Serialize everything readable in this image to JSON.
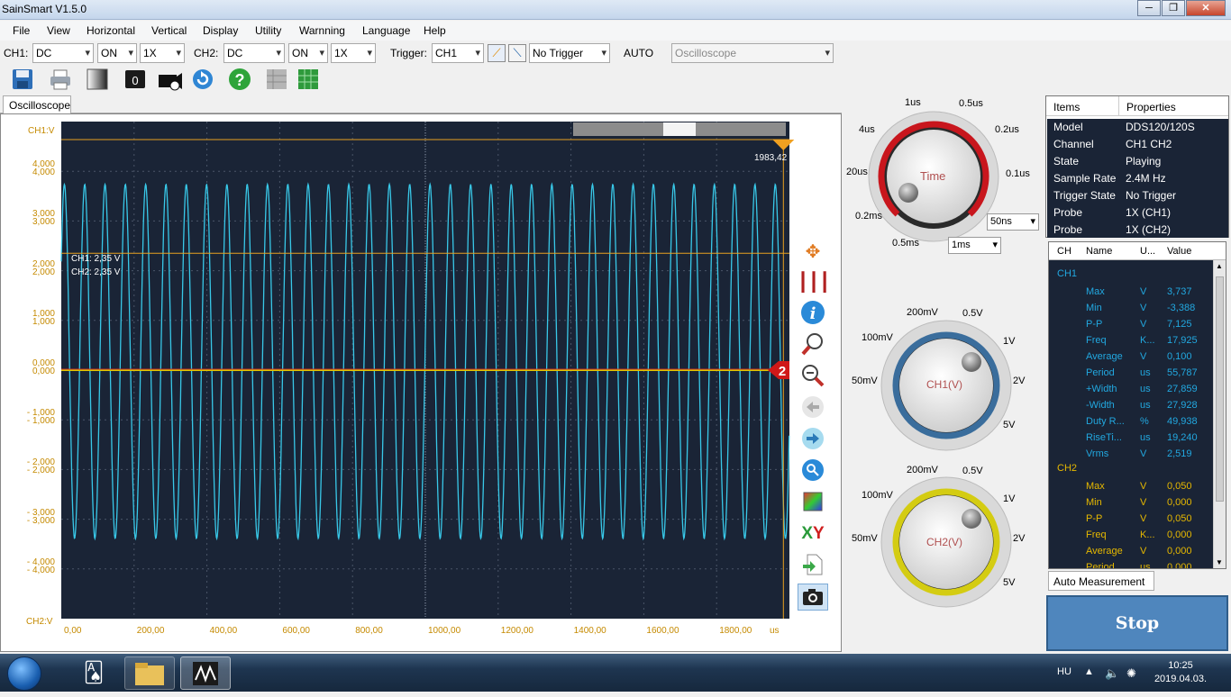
{
  "window": {
    "title": "SainSmart V1.5.0"
  },
  "menu": [
    "File",
    "View",
    "Horizontal",
    "Vertical",
    "Display",
    "Utility",
    "Warnning",
    "Language",
    "Help"
  ],
  "toolbar": {
    "ch1_label": "CH1:",
    "ch1_coupling": "DC",
    "ch1_state": "ON",
    "ch1_probe": "1X",
    "ch2_label": "CH2:",
    "ch2_coupling": "DC",
    "ch2_state": "ON",
    "ch2_probe": "1X",
    "trigger_label": "Trigger:",
    "trigger_source": "CH1",
    "trigger_mode": "No Trigger",
    "auto_label": "AUTO",
    "mode_select": "Oscilloscope"
  },
  "toolbar2": {
    "counter_value": "0"
  },
  "tab": {
    "label": "Oscilloscope"
  },
  "scope": {
    "ch1_axis_label": "CH1:V",
    "ch2_axis_label": "CH2:V",
    "cursor_ch1": "CH1: 2,35 V",
    "cursor_ch2": "CH2: 2,35 V",
    "trigger_time_label": "1983,42",
    "trigger_marker": "2",
    "x_unit": "us",
    "x_ticks": [
      "0,00",
      "200,00",
      "400,00",
      "600,00",
      "800,00",
      "1000,00",
      "1200,00",
      "1400,00",
      "1600,00",
      "1800,00"
    ],
    "y_ticks_ch1": [
      "4,000",
      "3,000",
      "2,000",
      "1,000",
      "0,000",
      "- 1,000",
      "- 2,000",
      "- 3,000",
      "- 4,000"
    ],
    "y_ticks_ch2": [
      "4,000",
      "3,000",
      "2,000",
      "1,000",
      "0,000",
      "- 1,000",
      "- 2,000",
      "- 3,000",
      "- 4,000"
    ],
    "colors": {
      "background": "#1a2436",
      "ch1": "#38c8e8",
      "ch2": "#e0c800",
      "cursor": "#e8a020",
      "grid": "#4a5568"
    }
  },
  "chart_data": {
    "type": "line",
    "xlim": [
      0,
      2000
    ],
    "ylim": [
      -5,
      5
    ],
    "xlabel": "us",
    "series": [
      {
        "name": "CH1",
        "shape": "sine",
        "frequency_khz": 17.925,
        "max": 3.737,
        "min": -3.388
      },
      {
        "name": "CH2",
        "shape": "flat",
        "value": 0.0
      }
    ],
    "cursor_y": 2.35,
    "trigger_x": 1983.42,
    "grid": true
  },
  "knobs": {
    "time": {
      "label": "Time",
      "scale": [
        "1us",
        "0.5us",
        "0.2us",
        "0.1us",
        "4us",
        "20us",
        "0.2ms",
        "0.5ms"
      ],
      "combo_fine": "50ns",
      "combo_coarse": "1ms"
    },
    "ch1": {
      "label": "CH1(V)",
      "scale": [
        "200mV",
        "0.5V",
        "100mV",
        "1V",
        "50mV",
        "2V",
        "5V"
      ]
    },
    "ch2": {
      "label": "CH2(V)",
      "scale": [
        "200mV",
        "0.5V",
        "100mV",
        "1V",
        "50mV",
        "2V",
        "5V"
      ]
    }
  },
  "properties": {
    "header": [
      "Items",
      "Properties"
    ],
    "rows": [
      {
        "item": "Model",
        "value": "DDS120/120S"
      },
      {
        "item": "Channel",
        "value": "CH1 CH2"
      },
      {
        "item": "State",
        "value": "Playing"
      },
      {
        "item": "Sample Rate",
        "value": "2.4M Hz"
      },
      {
        "item": "Trigger State",
        "value": "No Trigger"
      },
      {
        "item": "Probe",
        "value": "1X (CH1)"
      },
      {
        "item": "Probe",
        "value": "1X (CH2)"
      }
    ]
  },
  "measurements": {
    "header": [
      "CH",
      "Name",
      "U...",
      "Value"
    ],
    "ch1_label": "CH1",
    "ch2_label": "CH2",
    "ch1": [
      {
        "name": "Max",
        "unit": "V",
        "value": "3,737"
      },
      {
        "name": "Min",
        "unit": "V",
        "value": "-3,388"
      },
      {
        "name": "P-P",
        "unit": "V",
        "value": "7,125"
      },
      {
        "name": "Freq",
        "unit": "K...",
        "value": "17,925"
      },
      {
        "name": "Average",
        "unit": "V",
        "value": "0,100"
      },
      {
        "name": "Period",
        "unit": "us",
        "value": "55,787"
      },
      {
        "name": "+Width",
        "unit": "us",
        "value": "27,859"
      },
      {
        "name": "-Width",
        "unit": "us",
        "value": "27,928"
      },
      {
        "name": "Duty R...",
        "unit": "%",
        "value": "49,938"
      },
      {
        "name": "RiseTi...",
        "unit": "us",
        "value": "19,240"
      },
      {
        "name": "Vrms",
        "unit": "V",
        "value": "2,519"
      }
    ],
    "ch2": [
      {
        "name": "Max",
        "unit": "V",
        "value": "0,050"
      },
      {
        "name": "Min",
        "unit": "V",
        "value": "0,000"
      },
      {
        "name": "P-P",
        "unit": "V",
        "value": "0,050"
      },
      {
        "name": "Freq",
        "unit": "K...",
        "value": "0,000"
      },
      {
        "name": "Average",
        "unit": "V",
        "value": "0,000"
      },
      {
        "name": "Period",
        "unit": "us",
        "value": "0,000"
      }
    ]
  },
  "auto_measurement_tab": "Auto Measurement",
  "stop_button": "Stop",
  "taskbar": {
    "lang": "HU",
    "time": "10:25",
    "date": "2019.04.03."
  }
}
